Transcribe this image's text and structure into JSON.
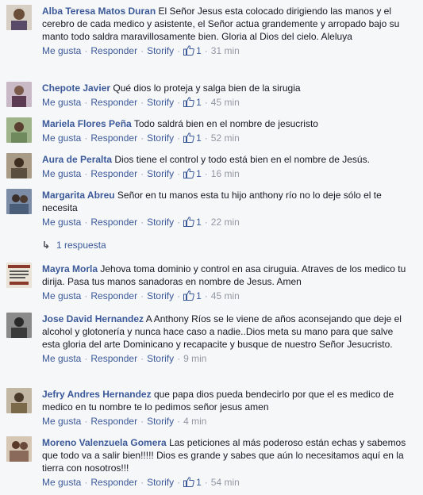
{
  "comments": [
    {
      "author": "Alba Teresa Matos Duran",
      "text": "El Señor Jesus esta colocado dirigiendo las manos y el cerebro de cada medico y asistente, el Señor actua grandemente y arropado bajo su manto todo saldra maravillosamente bien. Gloria al Dios del cielo. Aleluya",
      "like": "Me gusta",
      "reply": "Responder",
      "storify": "Storify",
      "likes": "1",
      "time": "31 min",
      "avatar_color": "#7a6a5a"
    },
    {
      "author": "Chepote Javier",
      "text": "Qué dios lo proteja y salga bien de la sirugia",
      "like": "Me gusta",
      "reply": "Responder",
      "storify": "Storify",
      "likes": "1",
      "time": "45 min",
      "avatar_color": "#5c3b52"
    },
    {
      "author": "Mariela Flores Peña",
      "text": "Todo saldrá bien en el nombre de jesucristo",
      "like": "Me gusta",
      "reply": "Responder",
      "storify": "Storify",
      "likes": "1",
      "time": "52 min",
      "avatar_color": "#6f8a5c"
    },
    {
      "author": "Aura de Peralta",
      "text": "Dios tiene el control y todo está bien en el nombre de Jesús.",
      "like": "Me gusta",
      "reply": "Responder",
      "storify": "Storify",
      "likes": "1",
      "time": "16 min",
      "avatar_color": "#5a4e3e"
    },
    {
      "author": "Margarita Abreu",
      "text": "Señor en tu manos esta tu hijo anthony río no lo deje sólo el te necesita",
      "like": "Me gusta",
      "reply": "Responder",
      "storify": "Storify",
      "likes": "1",
      "time": "22 min",
      "avatar_color": "#4a5e7a"
    },
    {
      "author": "Mayra Morla",
      "text": "Jehova toma dominio y control en asa ciruguia. Atraves de los medico tu dirija. Pasa tus manos sanadoras en nombre de Jesus. Amen",
      "like": "Me gusta",
      "reply": "Responder",
      "storify": "Storify",
      "likes": "1",
      "time": "45 min",
      "avatar_color": "#8a3a2a"
    },
    {
      "author": "Jose David Hernandez",
      "text": "A Anthony Ríos se le viene de años aconsejando que deje el alcohol y glotonería y nunca hace caso a nadie..Dios meta su mano para que salve esta gloria del arte Dominicano y recapacite y busque de nuestro Señor Jesucristo.",
      "like": "Me gusta",
      "reply": "Responder",
      "storify": "Storify",
      "likes": "",
      "time": "9 min",
      "avatar_color": "#3a3a3a"
    },
    {
      "author": "Jefry Andres Hernandez",
      "text": "que papa dios pueda bendecirlo por que el es medico de medico en tu nombre te lo pedimos señor jesus amen",
      "like": "Me gusta",
      "reply": "Responder",
      "storify": "Storify",
      "likes": "",
      "time": "4 min",
      "avatar_color": "#7a6a4a"
    },
    {
      "author": "Moreno Valenzuela Gomera",
      "text": "Las peticiones al más poderoso están echas y sabemos que todo va a salir bien!!!!! Dios es grande y sabes que aún lo necesitamos aquí en la tierra con nosotros!!!",
      "like": "Me gusta",
      "reply": "Responder",
      "storify": "Storify",
      "likes": "1",
      "time": "54 min",
      "avatar_color": "#8a6a5a"
    }
  ],
  "replies_link": "1 respuesta",
  "colors": {
    "link": "#3b5998",
    "meta": "#9197a3",
    "bg": "#f6f7f9"
  }
}
